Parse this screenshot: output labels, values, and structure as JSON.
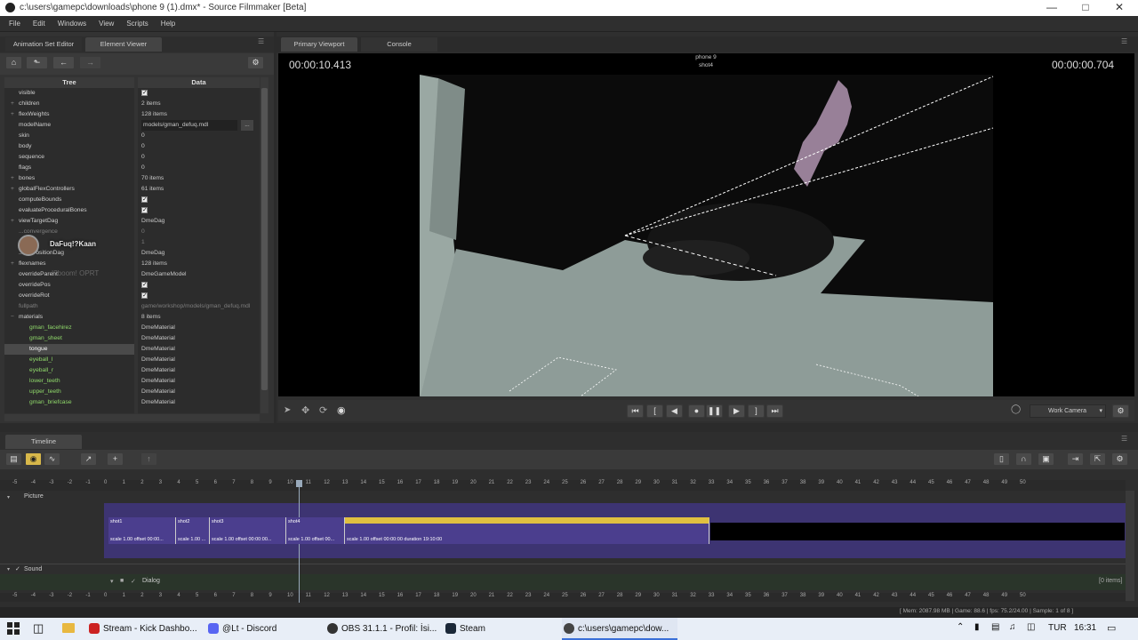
{
  "window": {
    "title": "c:\\users\\gamepc\\downloads\\phone 9 (1).dmx* - Source Filmmaker [Beta]"
  },
  "menu": [
    "File",
    "Edit",
    "Windows",
    "View",
    "Scripts",
    "Help"
  ],
  "left_panel": {
    "tabs": [
      "Animation Set Editor",
      "Element Viewer"
    ],
    "col_tree": "Tree",
    "col_data": "Data",
    "rows": [
      {
        "name": "visible",
        "data": "",
        "check": true,
        "level": 0
      },
      {
        "name": "children",
        "data": "2 items",
        "level": 0,
        "expand": true
      },
      {
        "name": "flexWeights",
        "data": "128 items",
        "level": 0,
        "expand": true
      },
      {
        "name": "modelName",
        "data": "models/gman_defuq.mdl",
        "level": 0,
        "field": true
      },
      {
        "name": "skin",
        "data": "0",
        "level": 0
      },
      {
        "name": "body",
        "data": "0",
        "level": 0
      },
      {
        "name": "sequence",
        "data": "0",
        "level": 0
      },
      {
        "name": "flags",
        "data": "0",
        "level": 0
      },
      {
        "name": "bones",
        "data": "70 items",
        "level": 0,
        "expand": true
      },
      {
        "name": "globalFlexControllers",
        "data": "61 items",
        "level": 0,
        "expand": true
      },
      {
        "name": "computeBounds",
        "data": "",
        "check": true,
        "level": 0
      },
      {
        "name": "evaluateProceduralBones",
        "data": "",
        "check": true,
        "level": 0
      },
      {
        "name": "viewTargetDag",
        "data": "DmeDag",
        "level": 0,
        "expand": true
      },
      {
        "name": "...convergence",
        "data": "0",
        "level": 0,
        "faded": true
      },
      {
        "name": "",
        "data": "1",
        "level": 0,
        "faded": true
      },
      {
        "name": "...umPositionDag",
        "data": "DmeDag",
        "level": 0
      },
      {
        "name": "flexnames",
        "data": "128 items",
        "level": 0,
        "expand": true
      },
      {
        "name": "overrideParent",
        "data": "DmeGameModel",
        "level": 0
      },
      {
        "name": "overridePos",
        "data": "",
        "check": true,
        "level": 0
      },
      {
        "name": "overrideRot",
        "data": "",
        "check": true,
        "level": 0
      },
      {
        "name": "fullpath",
        "data": "game/workshop/models/gman_defuq.mdl",
        "level": 0,
        "faded": true
      },
      {
        "name": "materials",
        "data": "8 items",
        "level": 0,
        "expand": true,
        "open": true
      },
      {
        "name": "gman_facehirez",
        "data": "DmeMaterial",
        "level": 1
      },
      {
        "name": "gman_sheet",
        "data": "DmeMaterial",
        "level": 1
      },
      {
        "name": "tongue",
        "data": "DmeMaterial",
        "level": 1,
        "selected": true
      },
      {
        "name": "eyeball_l",
        "data": "DmeMaterial",
        "level": 1
      },
      {
        "name": "eyeball_r",
        "data": "DmeMaterial",
        "level": 1
      },
      {
        "name": "lower_teeth",
        "data": "DmeMaterial",
        "level": 1
      },
      {
        "name": "upper_teeth",
        "data": "DmeMaterial",
        "level": 1
      },
      {
        "name": "gman_briefcase",
        "data": "DmeMaterial",
        "level": 1
      }
    ],
    "overlay_user": "DaFuq!?Kaan",
    "overlay_text": "!?boom! OPRT",
    "field_button": "..."
  },
  "viewport": {
    "tabs": [
      "Primary Viewport",
      "Console"
    ],
    "time_left": "00:00:10.413",
    "time_right": "00:00:00.704",
    "shot_title": "phone 9",
    "shot_sub": "shot4",
    "camera_label": "Work Camera"
  },
  "timeline": {
    "tab": "Timeline",
    "track_picture": "Picture",
    "track_sound": "Sound",
    "track_dialog": "Dialog",
    "dialog_items": "[0 items]",
    "ruler_start": -7,
    "ruler_labels": [
      "-7",
      "-6",
      "-5",
      "-4",
      "-3",
      "-2",
      "-1",
      "0",
      "1",
      "2",
      "3",
      "4",
      "5",
      "6",
      "7",
      "8",
      "9",
      "10",
      "11",
      "12",
      "13",
      "14",
      "15",
      "16",
      "17",
      "18",
      "19",
      "20",
      "21",
      "22",
      "23",
      "24",
      "25",
      "26",
      "27",
      "28",
      "29",
      "30",
      "31",
      "32",
      "33",
      "34",
      "35",
      "36",
      "37",
      "38",
      "39",
      "40",
      "41",
      "42",
      "43",
      "44",
      "45",
      "46",
      "47",
      "48",
      "49",
      "50"
    ],
    "shots": [
      {
        "name": "shot1",
        "detail": "scale 1.00 offset 00:00..."
      },
      {
        "name": "shot2",
        "detail": "scale 1.00 ..."
      },
      {
        "name": "shot3",
        "detail": "scale 1.00 offset 00:00:00..."
      },
      {
        "name": "shot4",
        "detail": "scale 1.00 offset 00..."
      },
      {
        "name": "shot5",
        "detail": "scale 1.00 offset 00:00:00 duration 19:10:00"
      }
    ],
    "status": "[ Mem: 2087.98 MB | Game: 88.6 | fps: 75.2/24.00 | Sample: 1 of 8 ]"
  },
  "taskbar": {
    "items": [
      {
        "label": "Stream - Kick Dashbo...",
        "color": "#cc2222"
      },
      {
        "label": "@Lt - Discord",
        "color": "#5865f2"
      },
      {
        "label": "OBS 31.1.1 - Profil: İsi...",
        "color": "#333333"
      },
      {
        "label": "Steam",
        "color": "#1b2838"
      },
      {
        "label": "c:\\users\\gamepc\\dow...",
        "color": "#444444"
      }
    ],
    "lang": "TUR",
    "clock": "16:31"
  }
}
